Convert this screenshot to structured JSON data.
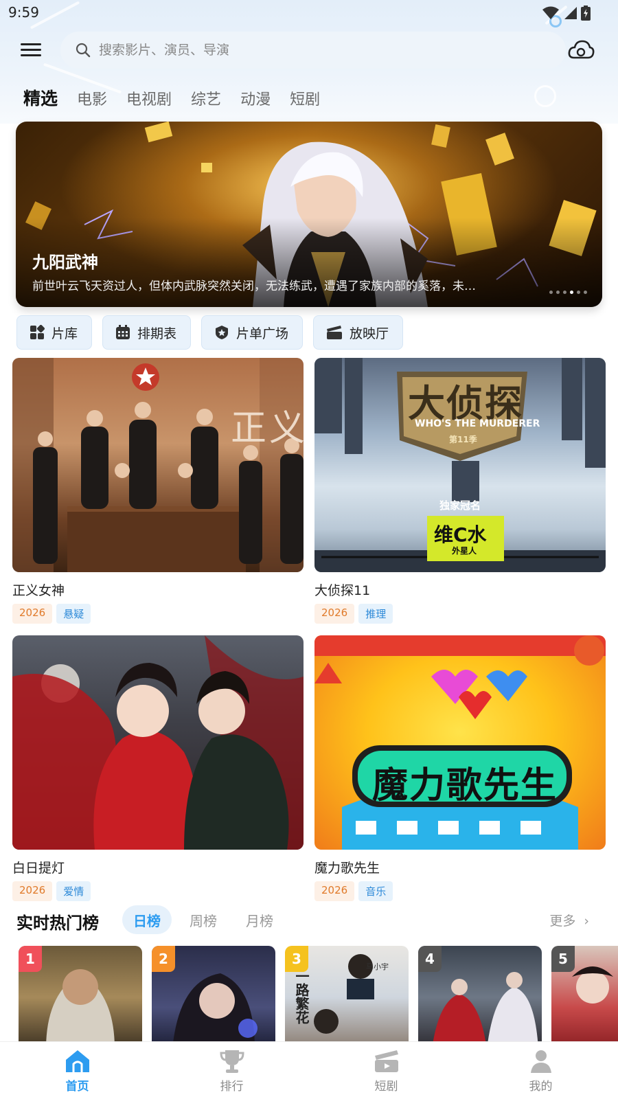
{
  "status_bar": {
    "time": "9:59",
    "icons": [
      "wifi-icon",
      "signal-icon",
      "battery-icon"
    ]
  },
  "header": {
    "menu_icon": "hamburger-menu-icon",
    "search": {
      "icon": "search-icon",
      "placeholder": "搜索影片、演员、导演",
      "value": ""
    },
    "cloud_icon": "cloud-sync-icon"
  },
  "tabs": [
    {
      "label": "精选",
      "active": true
    },
    {
      "label": "电影"
    },
    {
      "label": "电视剧"
    },
    {
      "label": "综艺"
    },
    {
      "label": "动漫"
    },
    {
      "label": "短剧"
    }
  ],
  "banner": {
    "title": "九阳武神",
    "description": "前世叶云飞天资过人，但体内武脉突然关闭，无法练武，遭遇了家族内部的奚落，未…",
    "dots_count": 6,
    "active_dot": 3
  },
  "quick_entries": [
    {
      "label": "片库",
      "icon": "grid-library-icon"
    },
    {
      "label": "排期表",
      "icon": "calendar-schedule-icon"
    },
    {
      "label": "片单广场",
      "icon": "shield-star-icon"
    },
    {
      "label": "放映厅",
      "icon": "clapperboard-icon"
    }
  ],
  "cards": [
    {
      "title": "正义女神",
      "year": "2026",
      "genre": "悬疑",
      "poster_text": "正义女"
    },
    {
      "title": "大侦探11",
      "year": "2026",
      "genre": "推理",
      "poster_text": "大侦探",
      "poster_sub": "WHO'S THE MURDERER",
      "poster_sponsor_label": "独家冠名",
      "poster_sponsor": "维C水",
      "poster_sponsor_brand": "外星人",
      "poster_season": "第11季"
    },
    {
      "title": "白日提灯",
      "year": "2026",
      "genre": "爱情"
    },
    {
      "title": "魔力歌先生",
      "year": "2026",
      "genre": "音乐",
      "poster_text": "魔力歌先生"
    }
  ],
  "ranking": {
    "title": "实时热门榜",
    "tabs": [
      {
        "label": "日榜",
        "active": true
      },
      {
        "label": "周榜"
      },
      {
        "label": "月榜"
      }
    ],
    "more": "更多",
    "items": [
      {
        "rank": "1",
        "color": "#f0505a"
      },
      {
        "rank": "2",
        "color": "#f5902a"
      },
      {
        "rank": "3",
        "color": "#f5c21f",
        "poster_text": "一路繁花",
        "poster_sub": "马小宇"
      },
      {
        "rank": "4",
        "color": "#555555"
      },
      {
        "rank": "5",
        "color": "#555555"
      }
    ]
  },
  "bottom_nav": [
    {
      "label": "首页",
      "icon": "home-icon",
      "active": true
    },
    {
      "label": "排行",
      "icon": "trophy-icon"
    },
    {
      "label": "短剧",
      "icon": "clapperboard-icon"
    },
    {
      "label": "我的",
      "icon": "user-profile-icon"
    }
  ],
  "colors": {
    "accent": "#2d9cf0",
    "year_tag": "#e07a2a",
    "genre_tag": "#2e8ad8"
  }
}
